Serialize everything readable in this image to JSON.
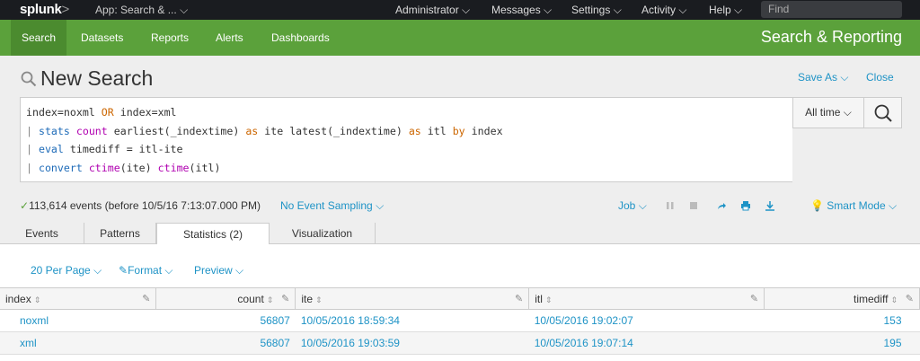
{
  "topbar": {
    "logo": "splunk",
    "logo_gt": ">",
    "app_label": "App: Search & ...",
    "menus": [
      "Administrator",
      "Messages",
      "Settings",
      "Activity",
      "Help"
    ],
    "find_placeholder": "Find"
  },
  "appnav": {
    "items": [
      "Search",
      "Datasets",
      "Reports",
      "Alerts",
      "Dashboards"
    ],
    "active": "Search",
    "app_title": "Search & Reporting"
  },
  "header": {
    "title": "New Search",
    "save_as": "Save As",
    "close": "Close"
  },
  "search": {
    "line1_a": "index=noxml ",
    "line1_op": "OR",
    "line1_b": " index=xml",
    "line2_pipe": "| ",
    "line2_cmd": "stats",
    "line2_sp": " ",
    "line2_fn": "count",
    "line2_a": " earliest(_indextime) ",
    "line2_as1": "as",
    "line2_b": " ite latest(_indextime) ",
    "line2_as2": "as",
    "line2_c": " itl ",
    "line2_by": "by",
    "line2_d": " index",
    "line3_pipe": "| ",
    "line3_cmd": "eval",
    "line3_a": " timediff = itl-ite",
    "line4_pipe": "| ",
    "line4_cmd": "convert",
    "line4_sp": " ",
    "line4_fn1": "ctime",
    "line4_a": "(ite) ",
    "line4_fn2": "ctime",
    "line4_b": "(itl)",
    "time_picker": "All time"
  },
  "status": {
    "events": "113,614 events (before 10/5/16 7:13:07.000 PM)",
    "sampling": "No Event Sampling",
    "job": "Job",
    "mode": "Smart Mode"
  },
  "tabs": [
    "Events",
    "Patterns",
    "Statistics (2)",
    "Visualization"
  ],
  "active_tab": "Statistics (2)",
  "results_toolbar": {
    "per_page": "20 Per Page",
    "format": "Format",
    "preview": "Preview"
  },
  "table": {
    "columns": [
      "index",
      "count",
      "ite",
      "itl",
      "timediff"
    ],
    "rows": [
      [
        "noxml",
        "56807",
        "10/05/2016 18:59:34",
        "10/05/2016 19:02:07",
        "153"
      ],
      [
        "xml",
        "56807",
        "10/05/2016 19:03:59",
        "10/05/2016 19:07:14",
        "195"
      ]
    ]
  },
  "colors": {
    "nav_green": "#5ba13b",
    "link_blue": "#1e93c6",
    "topbar": "#1a1c20"
  }
}
